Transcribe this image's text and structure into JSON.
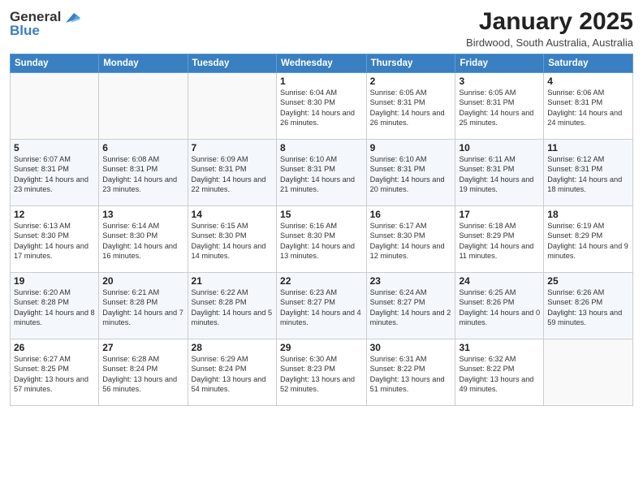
{
  "logo": {
    "general": "General",
    "blue": "Blue"
  },
  "header": {
    "title": "January 2025",
    "subtitle": "Birdwood, South Australia, Australia"
  },
  "weekdays": [
    "Sunday",
    "Monday",
    "Tuesday",
    "Wednesday",
    "Thursday",
    "Friday",
    "Saturday"
  ],
  "weeks": [
    [
      {
        "day": "",
        "info": ""
      },
      {
        "day": "",
        "info": ""
      },
      {
        "day": "",
        "info": ""
      },
      {
        "day": "1",
        "info": "Sunrise: 6:04 AM\nSunset: 8:30 PM\nDaylight: 14 hours\nand 26 minutes."
      },
      {
        "day": "2",
        "info": "Sunrise: 6:05 AM\nSunset: 8:31 PM\nDaylight: 14 hours\nand 26 minutes."
      },
      {
        "day": "3",
        "info": "Sunrise: 6:05 AM\nSunset: 8:31 PM\nDaylight: 14 hours\nand 25 minutes."
      },
      {
        "day": "4",
        "info": "Sunrise: 6:06 AM\nSunset: 8:31 PM\nDaylight: 14 hours\nand 24 minutes."
      }
    ],
    [
      {
        "day": "5",
        "info": "Sunrise: 6:07 AM\nSunset: 8:31 PM\nDaylight: 14 hours\nand 23 minutes."
      },
      {
        "day": "6",
        "info": "Sunrise: 6:08 AM\nSunset: 8:31 PM\nDaylight: 14 hours\nand 23 minutes."
      },
      {
        "day": "7",
        "info": "Sunrise: 6:09 AM\nSunset: 8:31 PM\nDaylight: 14 hours\nand 22 minutes."
      },
      {
        "day": "8",
        "info": "Sunrise: 6:10 AM\nSunset: 8:31 PM\nDaylight: 14 hours\nand 21 minutes."
      },
      {
        "day": "9",
        "info": "Sunrise: 6:10 AM\nSunset: 8:31 PM\nDaylight: 14 hours\nand 20 minutes."
      },
      {
        "day": "10",
        "info": "Sunrise: 6:11 AM\nSunset: 8:31 PM\nDaylight: 14 hours\nand 19 minutes."
      },
      {
        "day": "11",
        "info": "Sunrise: 6:12 AM\nSunset: 8:31 PM\nDaylight: 14 hours\nand 18 minutes."
      }
    ],
    [
      {
        "day": "12",
        "info": "Sunrise: 6:13 AM\nSunset: 8:30 PM\nDaylight: 14 hours\nand 17 minutes."
      },
      {
        "day": "13",
        "info": "Sunrise: 6:14 AM\nSunset: 8:30 PM\nDaylight: 14 hours\nand 16 minutes."
      },
      {
        "day": "14",
        "info": "Sunrise: 6:15 AM\nSunset: 8:30 PM\nDaylight: 14 hours\nand 14 minutes."
      },
      {
        "day": "15",
        "info": "Sunrise: 6:16 AM\nSunset: 8:30 PM\nDaylight: 14 hours\nand 13 minutes."
      },
      {
        "day": "16",
        "info": "Sunrise: 6:17 AM\nSunset: 8:30 PM\nDaylight: 14 hours\nand 12 minutes."
      },
      {
        "day": "17",
        "info": "Sunrise: 6:18 AM\nSunset: 8:29 PM\nDaylight: 14 hours\nand 11 minutes."
      },
      {
        "day": "18",
        "info": "Sunrise: 6:19 AM\nSunset: 8:29 PM\nDaylight: 14 hours\nand 9 minutes."
      }
    ],
    [
      {
        "day": "19",
        "info": "Sunrise: 6:20 AM\nSunset: 8:28 PM\nDaylight: 14 hours\nand 8 minutes."
      },
      {
        "day": "20",
        "info": "Sunrise: 6:21 AM\nSunset: 8:28 PM\nDaylight: 14 hours\nand 7 minutes."
      },
      {
        "day": "21",
        "info": "Sunrise: 6:22 AM\nSunset: 8:28 PM\nDaylight: 14 hours\nand 5 minutes."
      },
      {
        "day": "22",
        "info": "Sunrise: 6:23 AM\nSunset: 8:27 PM\nDaylight: 14 hours\nand 4 minutes."
      },
      {
        "day": "23",
        "info": "Sunrise: 6:24 AM\nSunset: 8:27 PM\nDaylight: 14 hours\nand 2 minutes."
      },
      {
        "day": "24",
        "info": "Sunrise: 6:25 AM\nSunset: 8:26 PM\nDaylight: 14 hours\nand 0 minutes."
      },
      {
        "day": "25",
        "info": "Sunrise: 6:26 AM\nSunset: 8:26 PM\nDaylight: 13 hours\nand 59 minutes."
      }
    ],
    [
      {
        "day": "26",
        "info": "Sunrise: 6:27 AM\nSunset: 8:25 PM\nDaylight: 13 hours\nand 57 minutes."
      },
      {
        "day": "27",
        "info": "Sunrise: 6:28 AM\nSunset: 8:24 PM\nDaylight: 13 hours\nand 56 minutes."
      },
      {
        "day": "28",
        "info": "Sunrise: 6:29 AM\nSunset: 8:24 PM\nDaylight: 13 hours\nand 54 minutes."
      },
      {
        "day": "29",
        "info": "Sunrise: 6:30 AM\nSunset: 8:23 PM\nDaylight: 13 hours\nand 52 minutes."
      },
      {
        "day": "30",
        "info": "Sunrise: 6:31 AM\nSunset: 8:22 PM\nDaylight: 13 hours\nand 51 minutes."
      },
      {
        "day": "31",
        "info": "Sunrise: 6:32 AM\nSunset: 8:22 PM\nDaylight: 13 hours\nand 49 minutes."
      },
      {
        "day": "",
        "info": ""
      }
    ]
  ]
}
